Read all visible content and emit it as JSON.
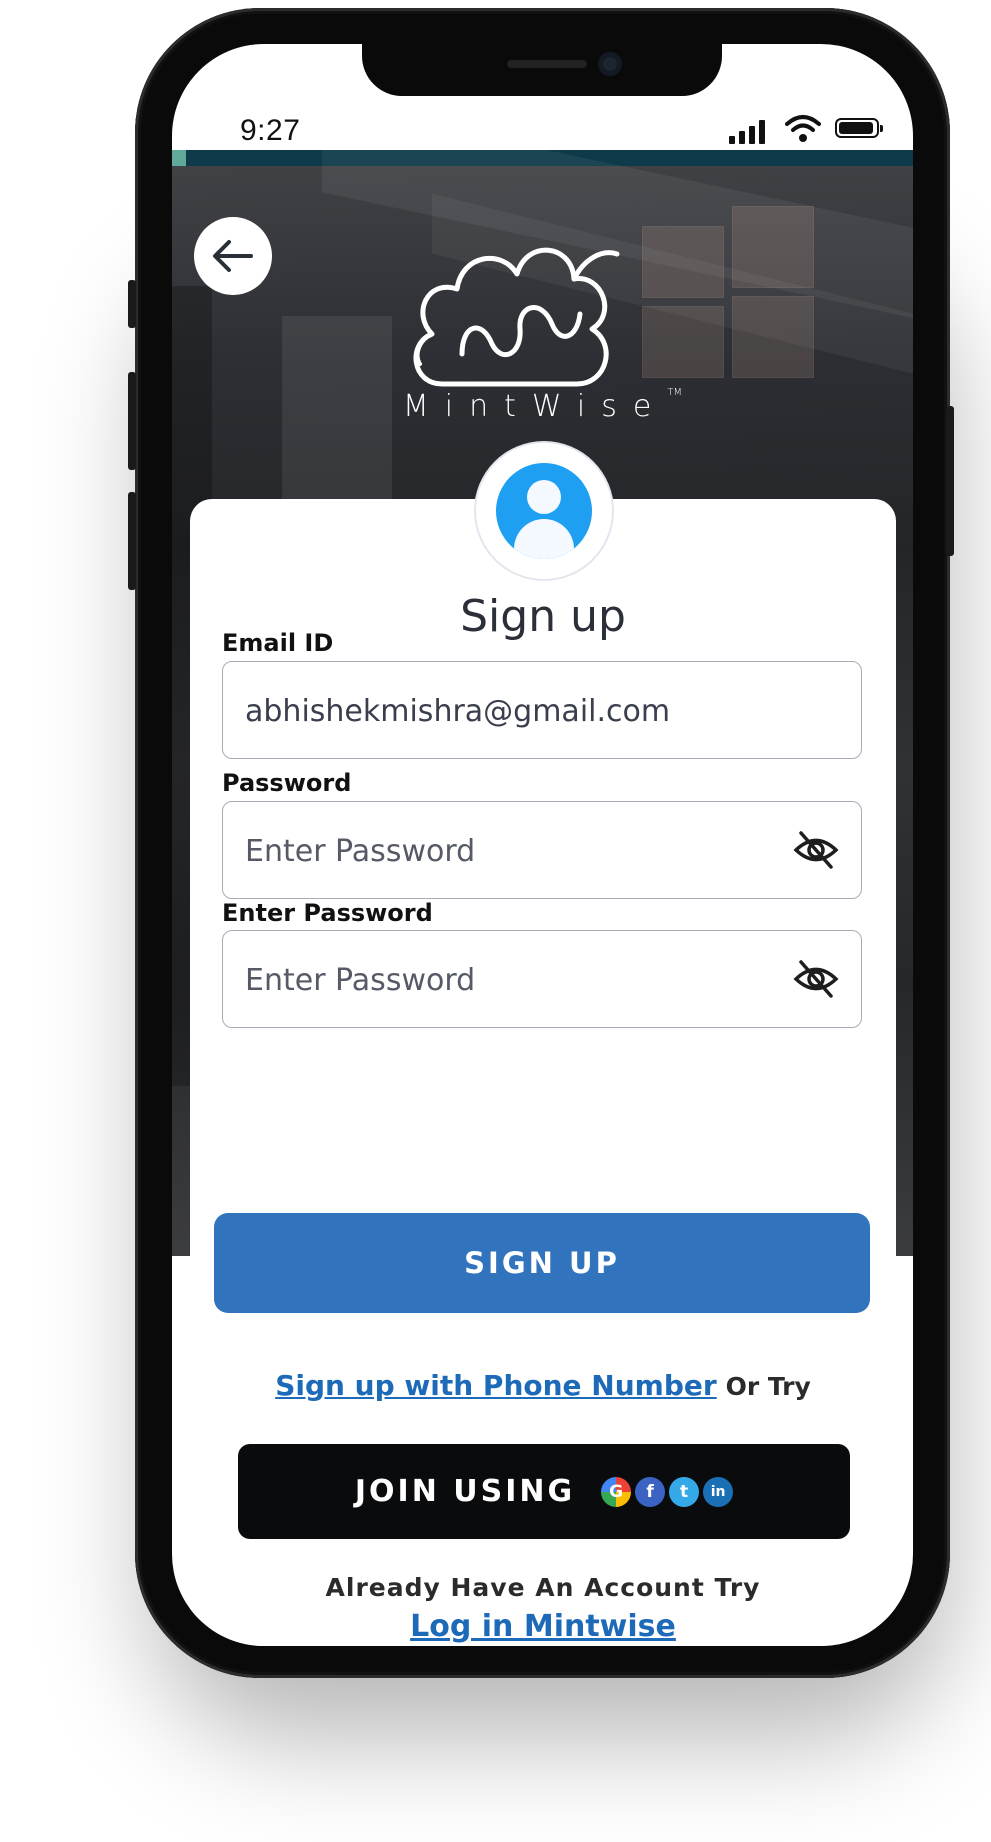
{
  "status_bar": {
    "time": "9:27"
  },
  "brand": {
    "name": "MintWise",
    "trademark": "TM"
  },
  "form": {
    "title": "Sign up",
    "email_label": "Email ID",
    "email_value": "abhishekmishra@gmail.com",
    "password_label": "Password",
    "password_placeholder": "Enter Password",
    "confirm_label": "Enter Password",
    "confirm_placeholder": "Enter Password",
    "submit_label": "SIGN UP"
  },
  "alt": {
    "phone_link": "Sign up with Phone Number",
    "or_try": "Or Try",
    "join_label": "JOIN USING",
    "social_icons": [
      "google-icon",
      "facebook-icon",
      "twitter-icon",
      "linkedin-icon"
    ],
    "already_text": "Already Have An Account Try",
    "login_link": "Log in  Mintwise"
  },
  "colors": {
    "primary_button": "#3173bc",
    "link": "#1d6ab8",
    "join_button": "#0a0b0d",
    "avatar": "#1e9ff2",
    "top_strip": "#0e3a4a"
  }
}
